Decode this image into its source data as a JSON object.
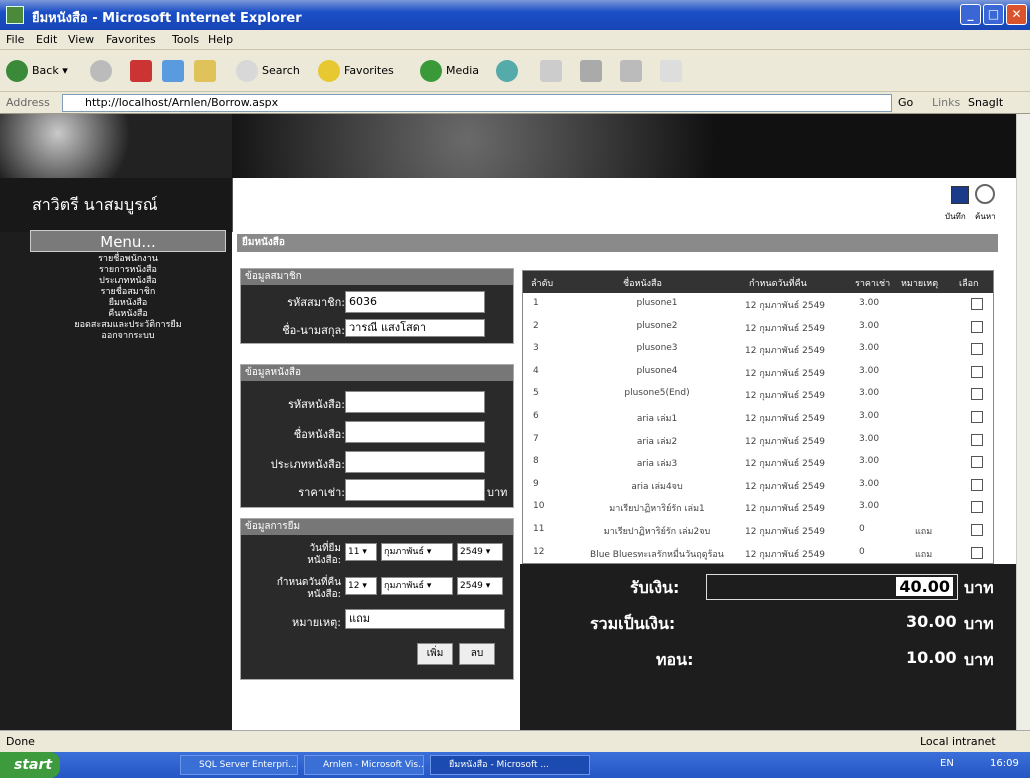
{
  "window": {
    "title": "ยืมหนังสือ - Microsoft Internet Explorer"
  },
  "menu": [
    "File",
    "Edit",
    "View",
    "Favorites",
    "Tools",
    "Help"
  ],
  "toolbar": {
    "back": "Back",
    "search": "Search",
    "favorites": "Favorites",
    "media": "Media"
  },
  "address": {
    "label": "Address",
    "url": "http://localhost/Arnlen/Borrow.aspx",
    "go": "Go",
    "links": "Links",
    "snagit": "SnagIt"
  },
  "sidebar": {
    "user_name": "สาวิตรี นาสมบูรณ์",
    "menu_title": "Menu...",
    "items": [
      "รายชื่อพนักงาน",
      "รายการหนังสือ",
      "ประเภทหนังสือ",
      "รายชื่อสมาชิก",
      "ยืมหนังสือ",
      "คืนหนังสือ",
      "ยอดสะสมและประวัติการยืม",
      "ออกจากระบบ"
    ]
  },
  "header_icons": {
    "save_label": "บันทึก",
    "search_label": "ค้นหา"
  },
  "main": {
    "section_title": "ยืมหนังสือ"
  },
  "member": {
    "heading": "ข้อมูลสมาชิก",
    "id_label": "รหัสสมาชิก:",
    "id_value": "6036",
    "name_label": "ชื่อ-นามสกุล:",
    "name_value": "วารณี แสงโสดา"
  },
  "book": {
    "heading": "ข้อมูลหนังสือ",
    "id_label": "รหัสหนังสือ:",
    "name_label": "ชื่อหนังสือ:",
    "type_label": "ประเภทหนังสือ:",
    "price_label": "ราคาเช่า:",
    "unit": "บาท"
  },
  "borrow": {
    "heading": "ข้อมูลการยืม",
    "date_label_1": "วันที่ยืม",
    "date_label_2": "หนังสือ:",
    "borrow_day": "11",
    "borrow_month": "กุมภาพันธ์",
    "borrow_year": "2549",
    "due_label_1": "กำหนดวันที่คืน",
    "due_label_2": "หนังสือ:",
    "due_day": "12",
    "due_month": "กุมภาพันธ์",
    "due_year": "2549",
    "note_label": "หมายเหตุ:",
    "note_value": "แถม",
    "add_button": "เพิ่ม",
    "delete_button": "ลบ"
  },
  "table": {
    "headers": [
      "ลำดับ",
      "ชื่อหนังสือ",
      "กำหนดวันที่คืน",
      "ราคาเช่า",
      "หมายเหตุ",
      "เลือก"
    ],
    "rows": [
      {
        "no": "1",
        "title": "plusone1",
        "due": "12 กุมภาพันธ์ 2549",
        "price": "3.00",
        "note": ""
      },
      {
        "no": "2",
        "title": "plusone2",
        "due": "12 กุมภาพันธ์ 2549",
        "price": "3.00",
        "note": ""
      },
      {
        "no": "3",
        "title": "plusone3",
        "due": "12 กุมภาพันธ์ 2549",
        "price": "3.00",
        "note": ""
      },
      {
        "no": "4",
        "title": "plusone4",
        "due": "12 กุมภาพันธ์ 2549",
        "price": "3.00",
        "note": ""
      },
      {
        "no": "5",
        "title": "plusone5(End)",
        "due": "12 กุมภาพันธ์ 2549",
        "price": "3.00",
        "note": ""
      },
      {
        "no": "6",
        "title": "aria เล่ม1",
        "due": "12 กุมภาพันธ์ 2549",
        "price": "3.00",
        "note": ""
      },
      {
        "no": "7",
        "title": "aria เล่ม2",
        "due": "12 กุมภาพันธ์ 2549",
        "price": "3.00",
        "note": ""
      },
      {
        "no": "8",
        "title": "aria เล่ม3",
        "due": "12 กุมภาพันธ์ 2549",
        "price": "3.00",
        "note": ""
      },
      {
        "no": "9",
        "title": "aria เล่ม4จบ",
        "due": "12 กุมภาพันธ์ 2549",
        "price": "3.00",
        "note": ""
      },
      {
        "no": "10",
        "title": "มาเรียปาฏิหาริย์รัก เล่ม1",
        "due": "12 กุมภาพันธ์ 2549",
        "price": "3.00",
        "note": ""
      },
      {
        "no": "11",
        "title": "มาเรียปาฏิหาริย์รัก เล่ม2จบ",
        "due": "12 กุมภาพันธ์ 2549",
        "price": "0",
        "note": "แถม"
      },
      {
        "no": "12",
        "title": "Blue Bluesทะเลรักหมื่นวันฤดูร้อน",
        "due": "12 กุมภาพันธ์ 2549",
        "price": "0",
        "note": "แถม"
      }
    ]
  },
  "totals": {
    "received_label": "รับเงิน:",
    "received_value": "40.00",
    "total_label": "รวมเป็นเงิน:",
    "total_value": "30.00",
    "change_label": "ทอน:",
    "change_value": "10.00",
    "unit": "บาท"
  },
  "status": {
    "text": "Done",
    "zone": "Local intranet"
  },
  "taskbar": {
    "start": "start",
    "tasks": [
      "SQL Server Enterpri...",
      "Arnlen - Microsoft Vis...",
      "ยืมหนังสือ - Microsoft ..."
    ],
    "lang": "EN",
    "clock": "16:09"
  }
}
